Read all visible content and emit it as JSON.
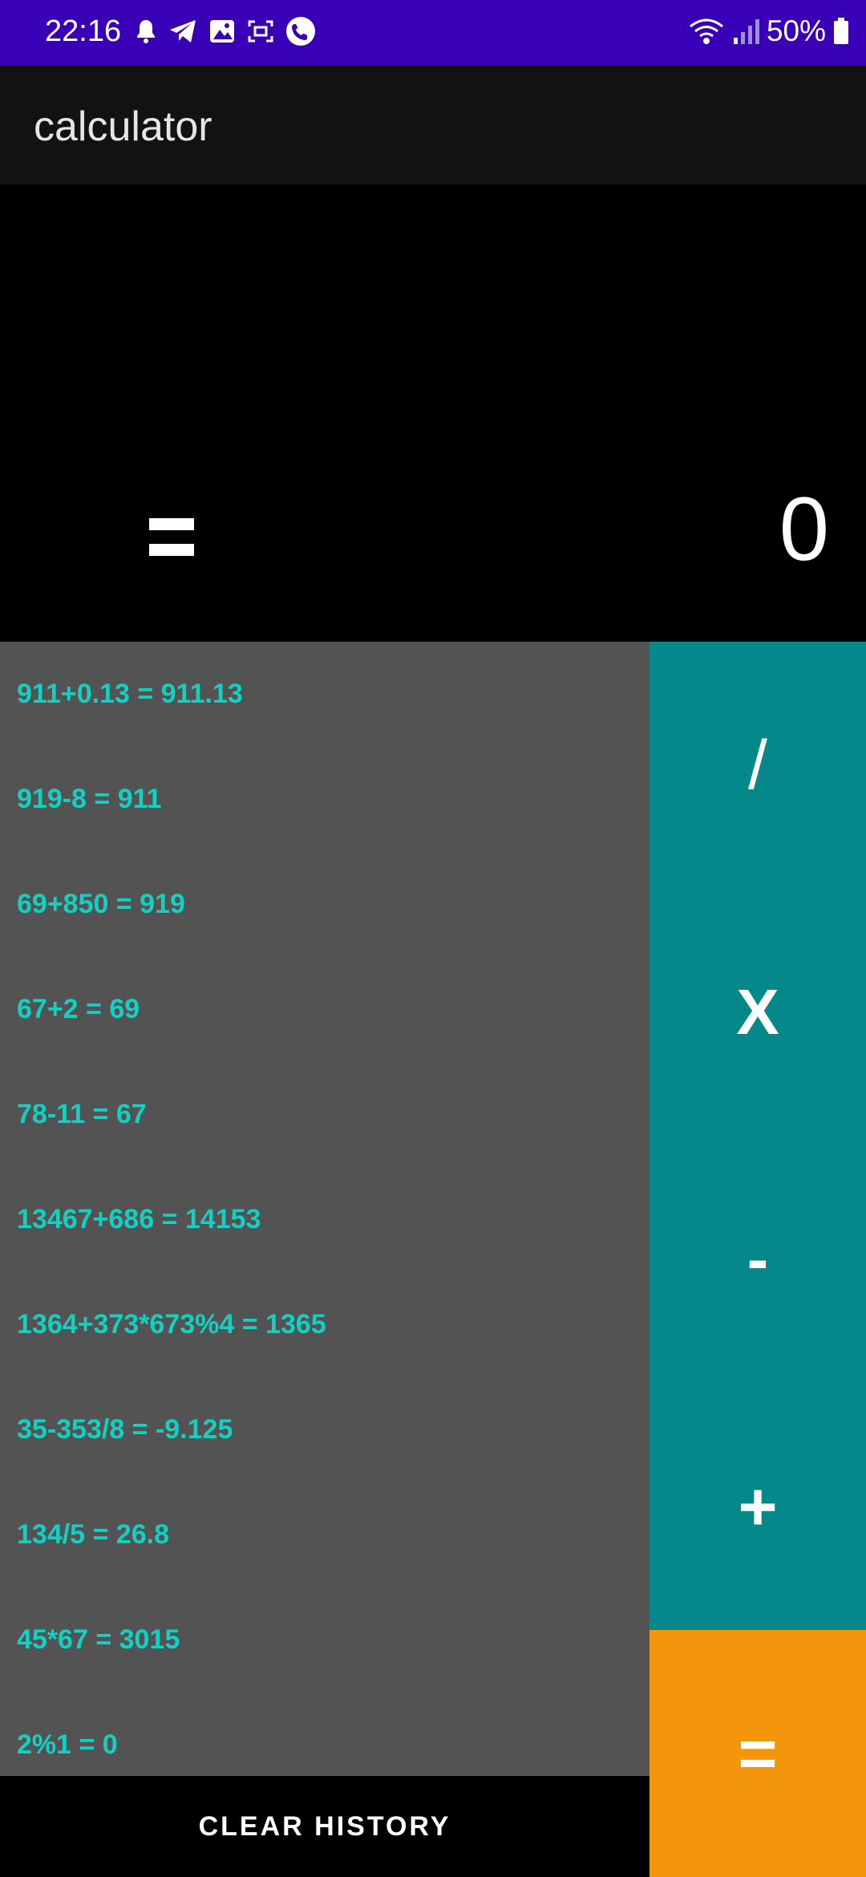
{
  "status_bar": {
    "time": "22:16",
    "battery": "50%",
    "background": "#3a00b8",
    "icons_left": [
      "notification-bell-icon",
      "telegram-icon",
      "image-icon",
      "screenshot-icon",
      "phone-call-icon"
    ],
    "icons_right": [
      "wifi-icon",
      "signal-icon",
      "battery-icon"
    ]
  },
  "app_bar": {
    "title": "calculator"
  },
  "display": {
    "value": "0"
  },
  "history": {
    "items": [
      "911+0.13 = 911.13",
      "919-8 = 911",
      "69+850 = 919",
      "67+2 = 69",
      "78-11 = 67",
      "13467+686 = 14153",
      "1364+373*673%4 = 1365",
      "35-353/8 = -9.125",
      "134/5 = 26.8",
      "45*67 = 3015",
      "2%1 = 0"
    ],
    "clear_label": "CLEAR HISTORY"
  },
  "operators": {
    "divide": "/",
    "multiply": "X",
    "subtract": "-",
    "add": "+",
    "equals": "="
  },
  "colors": {
    "history_text": "#13d1c2",
    "history_bg": "#535353",
    "operator_bg": "#05888a",
    "equals_bg": "#f3960c"
  }
}
